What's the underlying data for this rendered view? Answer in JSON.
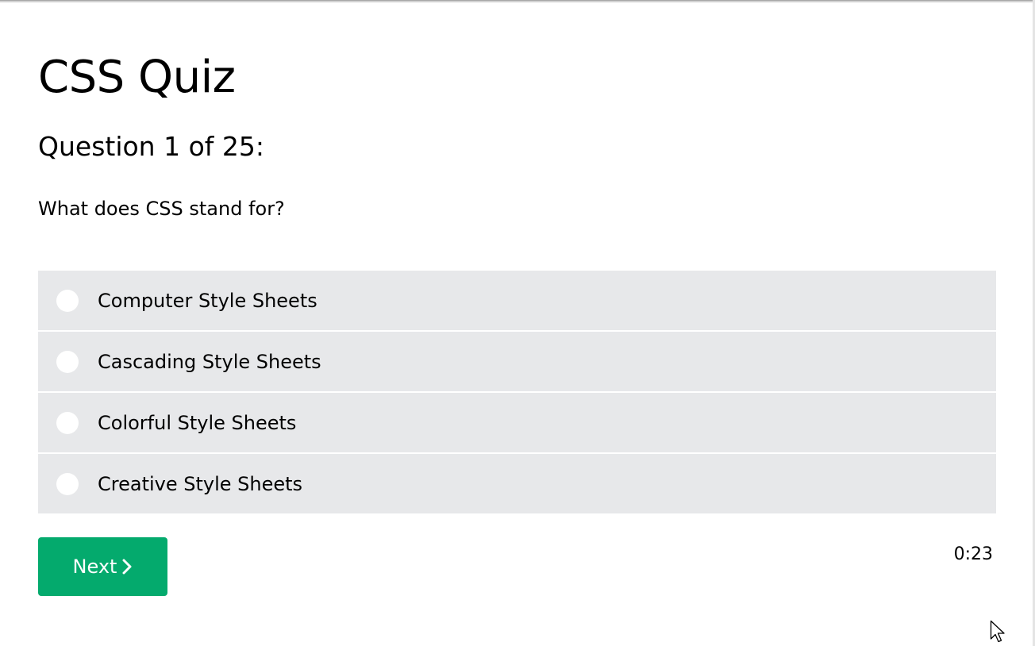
{
  "quiz": {
    "title": "CSS Quiz",
    "counter": "Question 1 of 25:",
    "question": "What does CSS stand for?",
    "options": [
      {
        "label": "Computer Style Sheets"
      },
      {
        "label": "Cascading Style Sheets"
      },
      {
        "label": "Colorful Style Sheets"
      },
      {
        "label": "Creative Style Sheets"
      }
    ],
    "next_label": "Next",
    "timer": "0:23"
  },
  "icons": {
    "next": "chevron-right-icon",
    "cursor": "mouse-pointer-icon",
    "radio": "radio-unselected-icon"
  },
  "colors": {
    "accent": "#04aa6d",
    "option_background": "#e7e8ea",
    "text": "#000000"
  }
}
